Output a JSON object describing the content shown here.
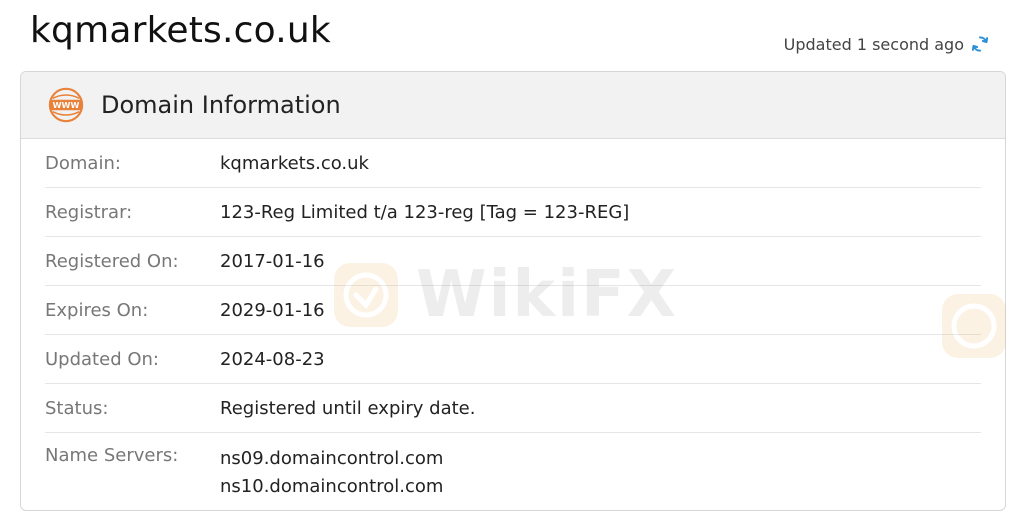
{
  "page": {
    "domain_title": "kqmarkets.co.uk",
    "updated_text": "Updated 1 second ago",
    "watermark_text": "WikiFX"
  },
  "card": {
    "title": "Domain Information",
    "icon": "www-icon",
    "rows": [
      {
        "label": "Domain:",
        "value": "kqmarkets.co.uk"
      },
      {
        "label": "Registrar:",
        "value": "123-Reg Limited t/a 123-reg [Tag = 123-REG]"
      },
      {
        "label": "Registered On:",
        "value": "2017-01-16"
      },
      {
        "label": "Expires On:",
        "value": "2029-01-16"
      },
      {
        "label": "Updated On:",
        "value": "2024-08-23"
      },
      {
        "label": "Status:",
        "value": "Registered until expiry date."
      }
    ],
    "name_servers": {
      "label": "Name Servers:",
      "values": [
        "ns09.domaincontrol.com",
        "ns10.domaincontrol.com"
      ]
    }
  },
  "colors": {
    "accent_icon": "#e8823a",
    "refresh_icon": "#2b8fd6",
    "header_bg": "#f2f2f2"
  }
}
